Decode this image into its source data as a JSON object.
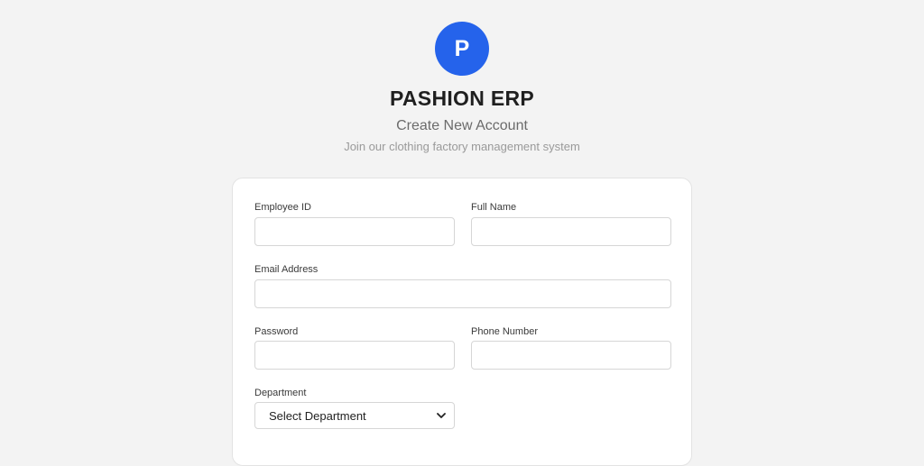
{
  "brand": {
    "logo_letter": "P",
    "name": "PASHION ERP",
    "subtitle": "Create New Account",
    "tagline": "Join our clothing factory management system",
    "accent_color": "#2563eb"
  },
  "form": {
    "employee_id": {
      "label": "Employee ID",
      "value": "",
      "placeholder": ""
    },
    "full_name": {
      "label": "Full Name",
      "value": "",
      "placeholder": ""
    },
    "email": {
      "label": "Email Address",
      "value": "",
      "placeholder": ""
    },
    "password": {
      "label": "Password",
      "value": "",
      "placeholder": ""
    },
    "phone": {
      "label": "Phone Number",
      "value": "",
      "placeholder": ""
    },
    "department": {
      "label": "Department",
      "selected": "Select Department",
      "icon": "chevron-down-icon"
    }
  }
}
